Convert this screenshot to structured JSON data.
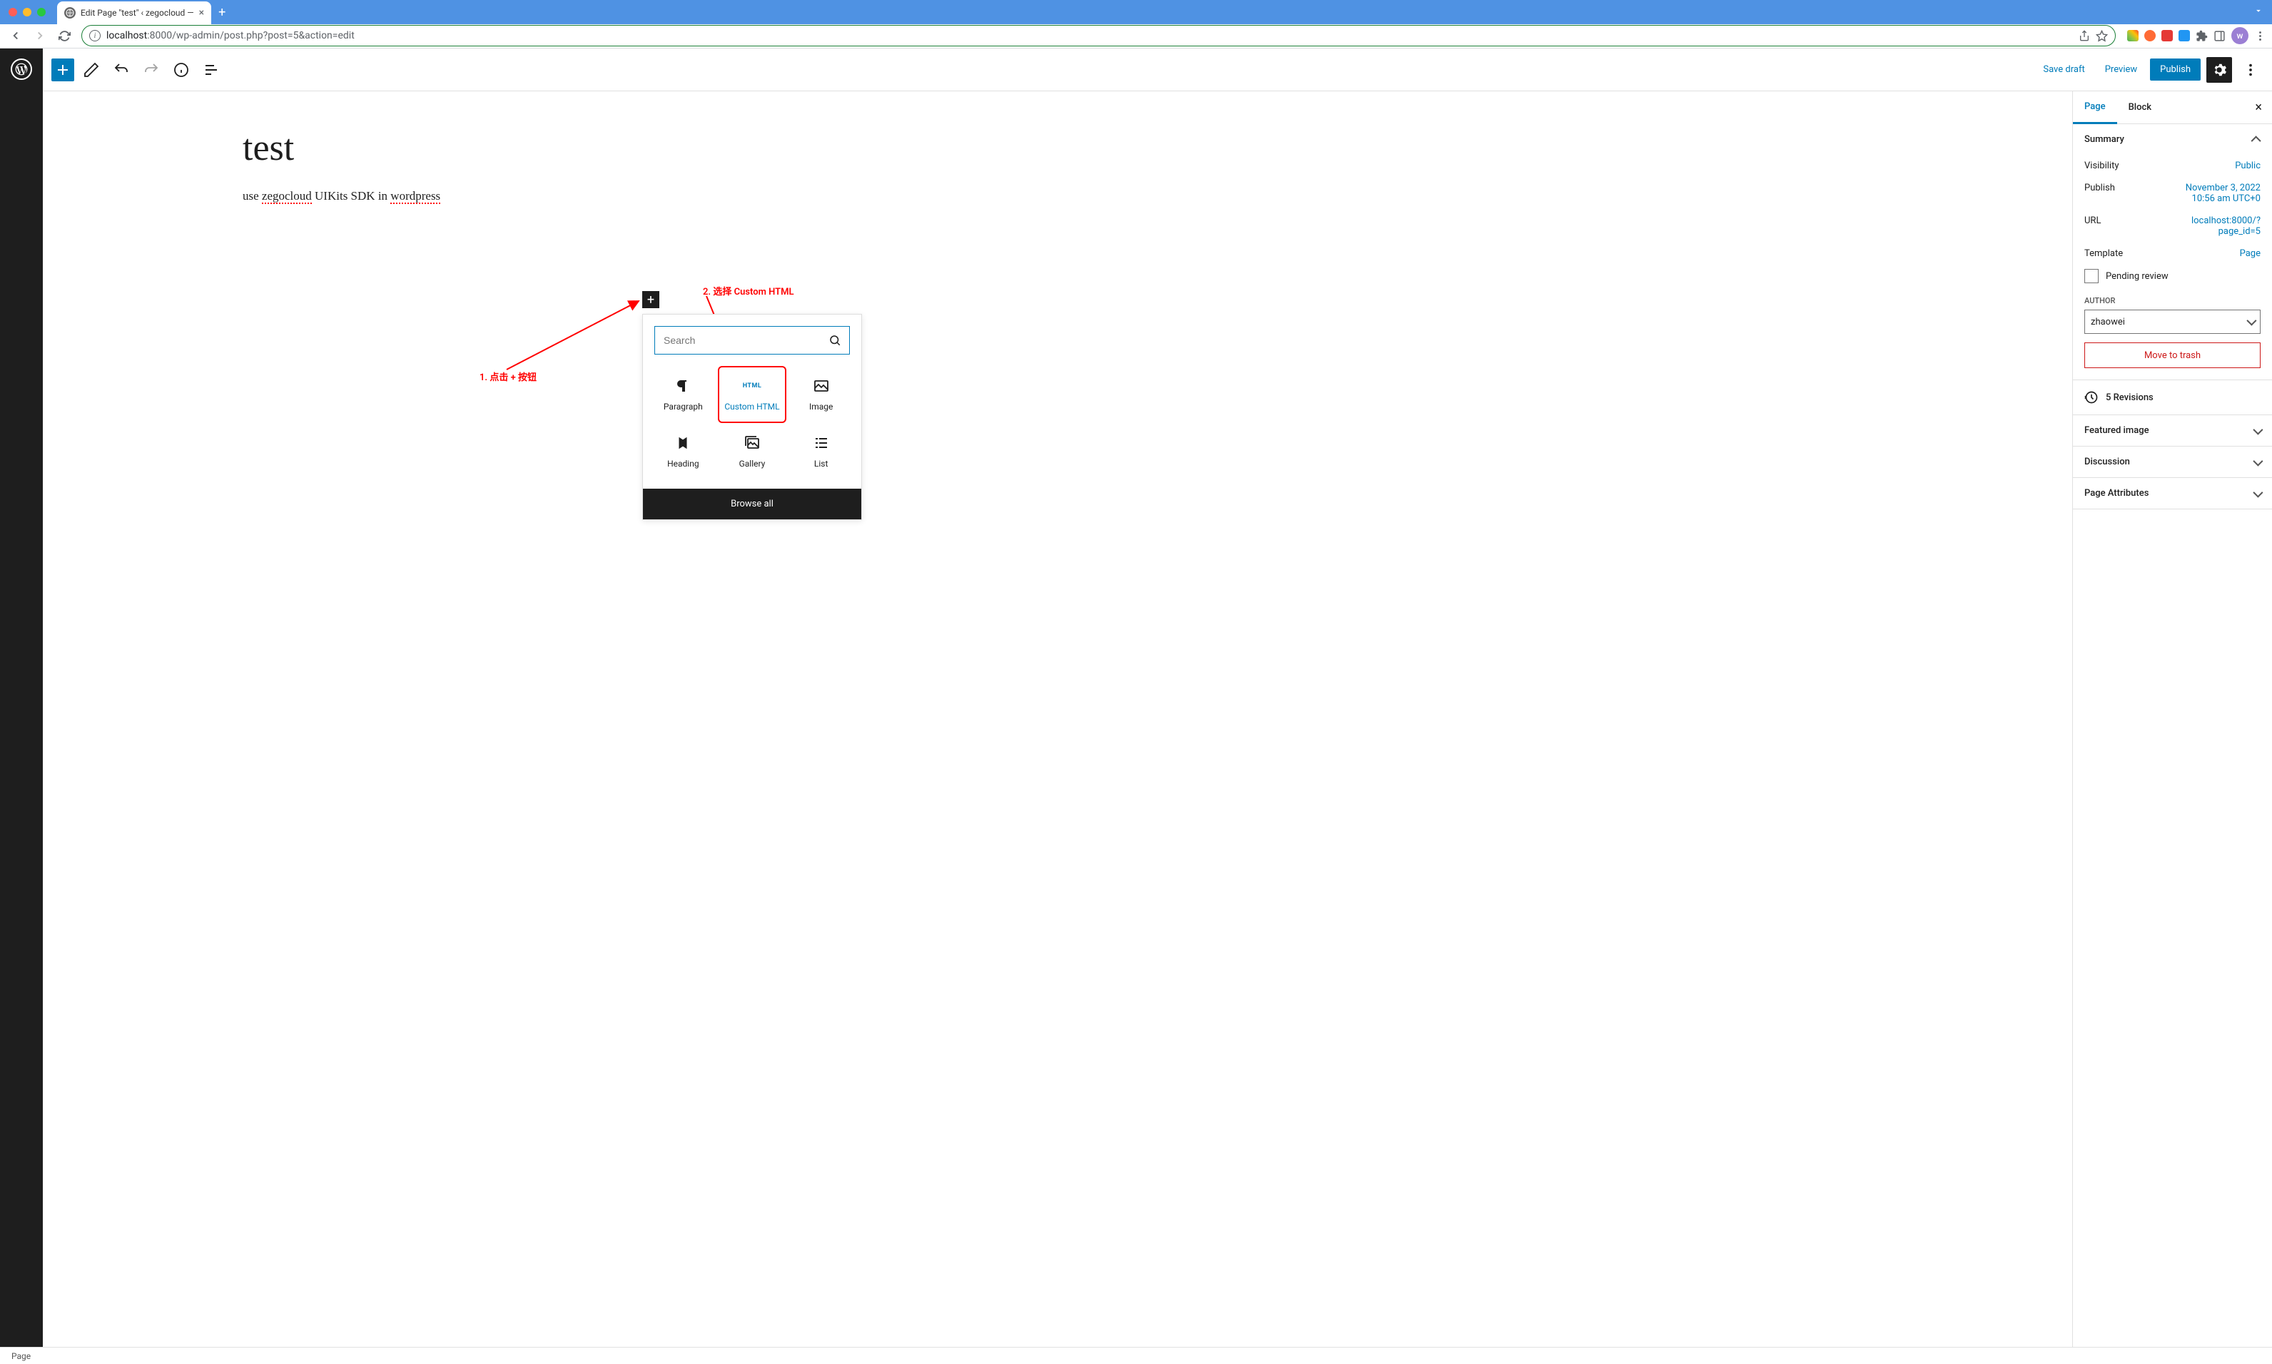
{
  "browser": {
    "tab_title": "Edit Page \"test\" ‹ zegocloud —",
    "url_host": "localhost",
    "url_port_path": ":8000/wp-admin/post.php?post=5&action=edit",
    "avatar_letter": "w"
  },
  "topbar": {
    "save_draft": "Save draft",
    "preview": "Preview",
    "publish": "Publish"
  },
  "content": {
    "title": "test",
    "body_prefix": "use ",
    "body_underlined1": "zegocloud",
    "body_mid": " UIKits SDK in ",
    "body_underlined2": "wordpress"
  },
  "annotations": {
    "step1": "1. 点击 + 按钮",
    "step2": "2. 选择 Custom HTML"
  },
  "inserter": {
    "search_placeholder": "Search",
    "blocks": {
      "paragraph": "Paragraph",
      "custom_html": "Custom HTML",
      "html_badge": "HTML",
      "image": "Image",
      "heading": "Heading",
      "gallery": "Gallery",
      "list": "List"
    },
    "browse_all": "Browse all"
  },
  "sidebar": {
    "tabs": {
      "page": "Page",
      "block": "Block"
    },
    "summary": {
      "title": "Summary",
      "visibility_label": "Visibility",
      "visibility_value": "Public",
      "publish_label": "Publish",
      "publish_value": "November 3, 2022 10:56 am UTC+0",
      "url_label": "URL",
      "url_value": "localhost:8000/?page_id=5",
      "template_label": "Template",
      "template_value": "Page",
      "pending_review": "Pending review",
      "author_label": "AUTHOR",
      "author_value": "zhaowei",
      "move_to_trash": "Move to trash"
    },
    "revisions": "5 Revisions",
    "featured_image": "Featured image",
    "discussion": "Discussion",
    "page_attributes": "Page Attributes"
  },
  "footer": {
    "breadcrumb": "Page"
  }
}
